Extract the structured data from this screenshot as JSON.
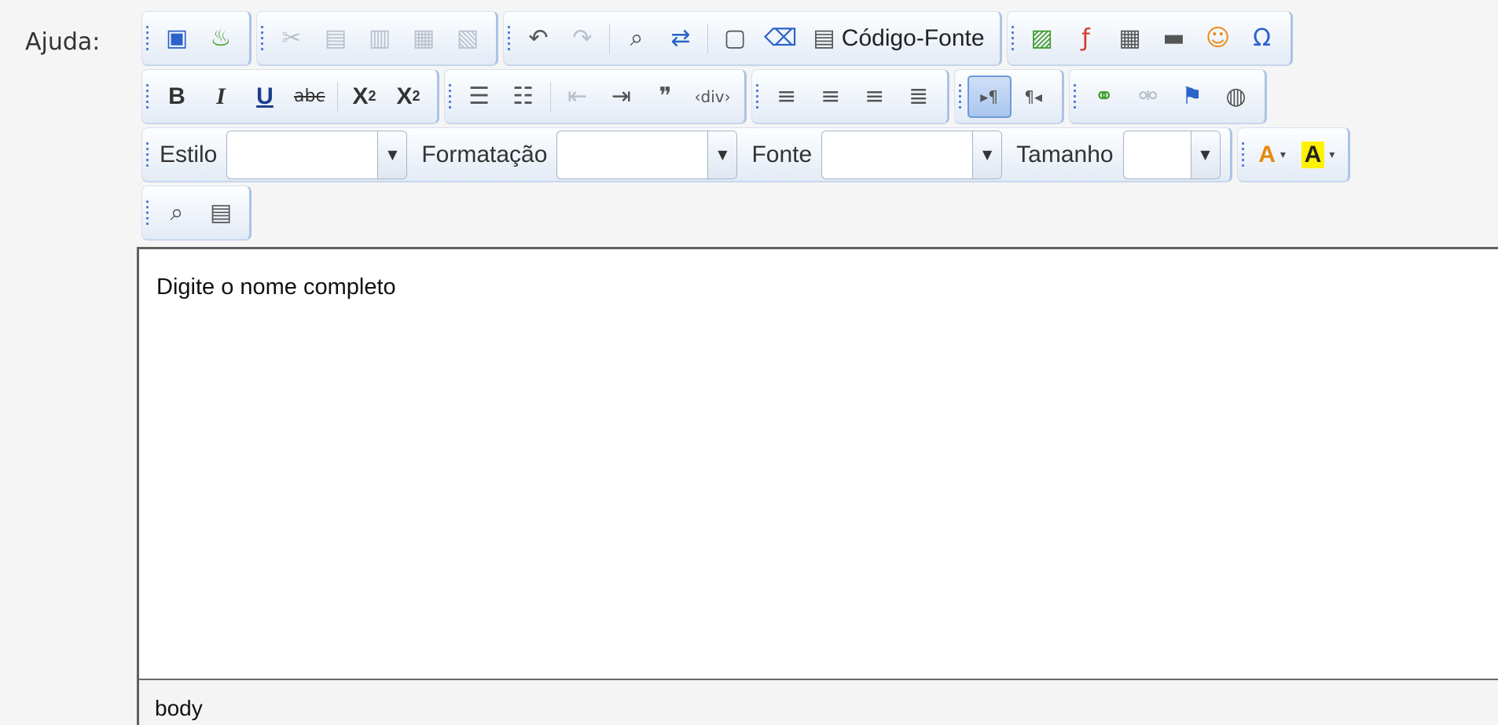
{
  "field": {
    "label": "Ajuda:"
  },
  "toolbar": {
    "row1": {
      "source_label": "Código-Fonte"
    },
    "row3": {
      "style_label": "Estilo",
      "style_value": "",
      "format_label": "Formatação",
      "format_value": "",
      "font_label": "Fonte",
      "font_value": "",
      "size_label": "Tamanho",
      "size_value": ""
    },
    "icons": {
      "spellcheck": "▣",
      "scayt": "♨",
      "cut": "✂",
      "copy": "▤",
      "paste": "▥",
      "paste_text": "▦",
      "paste_word": "▧",
      "undo": "↶",
      "redo": "↷",
      "find": "⌕",
      "replace": "⇄",
      "select_all": "▢",
      "remove_format": "⌫",
      "source": "▤",
      "image": "▨",
      "flash": "ƒ",
      "table": "▦",
      "hr": "▬",
      "smiley": "☺",
      "special_char": "Ω",
      "bold": "B",
      "italic": "I",
      "underline": "U",
      "strike": "abc",
      "subscript": "X",
      "subscript_small": "2",
      "superscript": "X",
      "superscript_small": "2",
      "numbered_list": "☰",
      "bulleted_list": "☷",
      "outdent": "⇤",
      "indent": "⇥",
      "blockquote": "❞",
      "create_div": "‹div›",
      "align_left": "≡",
      "align_center": "≡",
      "align_right": "≡",
      "justify": "≣",
      "ltr": "▸¶",
      "rtl": "¶◂",
      "link": "⚭",
      "unlink": "⚮",
      "anchor": "⚑",
      "globe": "◍",
      "text_color": "A",
      "bg_color": "A",
      "preview": "⌕",
      "templates": "▤",
      "caret": "▾",
      "dropdown_arrow": "▼"
    }
  },
  "editor": {
    "content": "Digite o nome completo"
  },
  "status": {
    "path": "body"
  }
}
